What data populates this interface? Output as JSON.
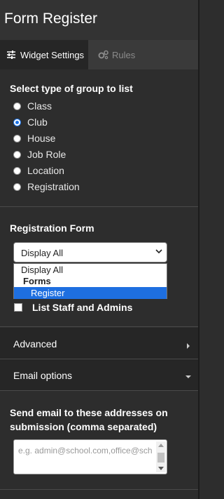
{
  "header": {
    "title": "Form Register"
  },
  "tabs": [
    {
      "label": "Widget Settings",
      "icon": "sliders-icon",
      "active": true
    },
    {
      "label": "Rules",
      "icon": "gears-icon",
      "active": false
    }
  ],
  "group_type": {
    "heading": "Select type of group to list",
    "options": [
      "Class",
      "Club",
      "House",
      "Job Role",
      "Location",
      "Registration"
    ],
    "selected": "Club"
  },
  "registration_form": {
    "heading": "Registration Form",
    "select_value": "Display All",
    "dropdown": {
      "option_display_all": "Display All",
      "group_label": "Forms",
      "option_register": "Register"
    }
  },
  "list_staff": {
    "label": "List Staff and Admins",
    "checked": false
  },
  "accordions": {
    "advanced": "Advanced",
    "email_options": "Email options"
  },
  "email": {
    "label": "Send email to these addresses on submission (comma separated)",
    "placeholder": "e.g. admin@school.com,office@sch"
  },
  "colors": {
    "background": "#2d2d2d",
    "accent": "#1e6fe0"
  }
}
